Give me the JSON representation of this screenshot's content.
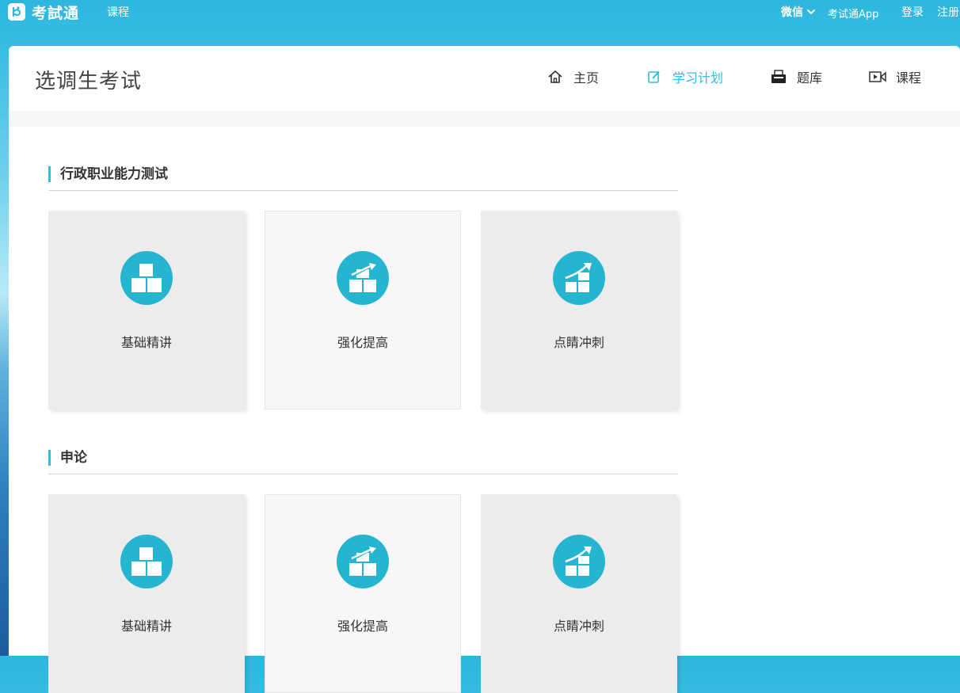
{
  "topbar": {
    "logo_text": "考試通",
    "course_link": "课程",
    "wechat_label": "微信",
    "app_link": "考试通App",
    "login": "登录",
    "register": "注册"
  },
  "header": {
    "page_title": "选调生考试",
    "nav": [
      {
        "label": "主页",
        "icon": "home-icon"
      },
      {
        "label": "学习计划",
        "icon": "edit-icon",
        "active": true
      },
      {
        "label": "题库",
        "icon": "printer-icon"
      },
      {
        "label": "课程",
        "icon": "video-icon"
      }
    ]
  },
  "sections": [
    {
      "title": "行政职业能力测试",
      "cards": [
        {
          "label": "基础精讲",
          "icon": "blocks-icon"
        },
        {
          "label": "强化提高",
          "icon": "blocks-growth-icon"
        },
        {
          "label": "点睛冲刺",
          "icon": "growth-arrow-icon"
        }
      ]
    },
    {
      "title": "申论",
      "cards": [
        {
          "label": "基础精讲",
          "icon": "blocks-icon"
        },
        {
          "label": "强化提高",
          "icon": "blocks-growth-icon"
        },
        {
          "label": "点睛冲刺",
          "icon": "growth-arrow-icon"
        }
      ]
    }
  ],
  "colors": {
    "accent": "#2bbde2",
    "icon_circle": "#25b5d1",
    "card_bg": "#ececec",
    "card_bg_light": "#f7f7f7"
  }
}
